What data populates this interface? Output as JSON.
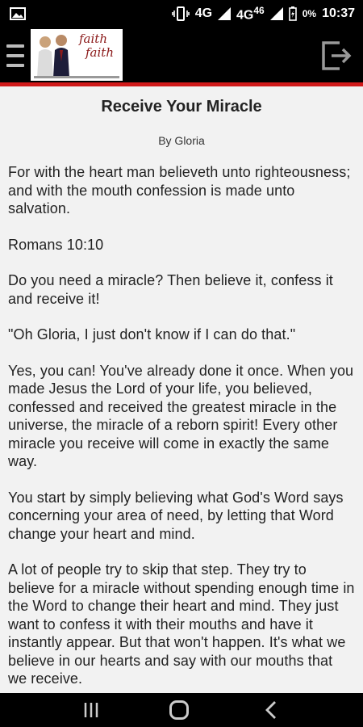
{
  "status": {
    "network1": "4G",
    "network2": "4G",
    "network2_sup": "46",
    "battery": "0%",
    "time": "10:37"
  },
  "appbar": {
    "logo_text_line1": "faith",
    "logo_text_line2": "faith",
    "accent_color": "#d11a1a"
  },
  "article": {
    "title": "Receive Your Miracle",
    "byline": "By Gloria",
    "paragraphs": [
      "For with the heart man believeth unto righteousness; and with the mouth confession is made unto salvation.",
      "Romans 10:10",
      "Do you need a miracle? Then believe it, confess it and receive it!",
      "\"Oh Gloria, I just don't know if I can do that.\"",
      "Yes, you can! You've already done it once. When you made Jesus the Lord of your life, you believed, confessed and received the greatest miracle in the universe, the miracle of a reborn spirit! Every other miracle you receive will come in exactly the same way.",
      "You start by simply believing what God's Word says concerning your area of need, by letting that Word change your heart and mind.",
      "A lot of people try to skip that step. They try to believe for a miracle without spending enough time in the Word to change their heart and mind. They just want to confess it with their mouths and have it instantly appear. But that won't happen. It's what we believe in our hearts and say with our mouths that we receive."
    ]
  },
  "icons": {
    "menu": "menu-icon",
    "exit": "exit-icon",
    "recent": "recent-apps-icon",
    "home": "home-icon",
    "back": "back-icon"
  }
}
